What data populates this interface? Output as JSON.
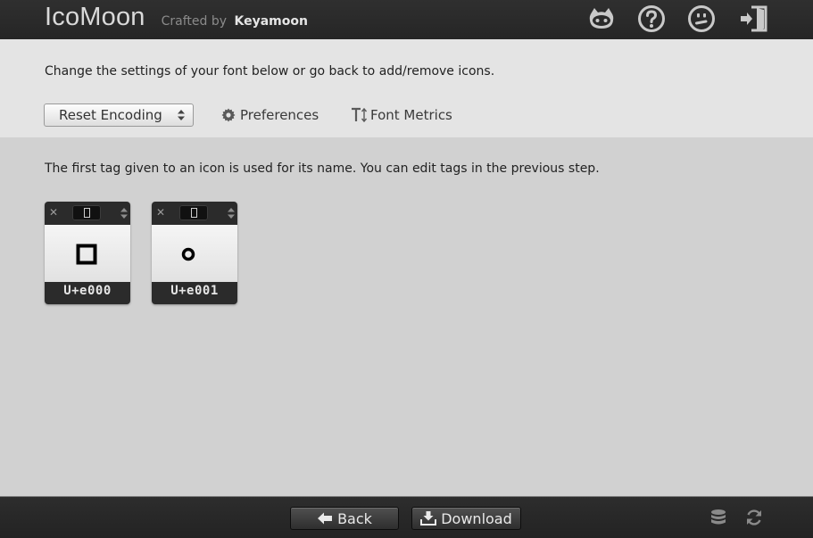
{
  "header": {
    "brand_name": "IcoMoon",
    "crafted_by": "Crafted by",
    "author": "Keyamoon",
    "icons": [
      "github-icon",
      "help-icon",
      "smiley-icon",
      "sign-out-icon"
    ]
  },
  "settings": {
    "intro_text": "Change the settings of your font below or go back to add/remove icons.",
    "encoding_select": "Reset Encoding",
    "preferences_label": "Preferences",
    "font_metrics_label": "Font Metrics"
  },
  "main": {
    "notice": "The first tag given to an icon is used for its name. You can edit tags in the previous step.",
    "glyphs": [
      {
        "code": "U+e000",
        "icon": "square-outline-icon"
      },
      {
        "code": "U+e001",
        "icon": "ring-icon"
      }
    ]
  },
  "footer": {
    "back_label": "Back",
    "download_label": "Download",
    "icons": [
      "database-icon",
      "refresh-icon"
    ]
  },
  "colors": {
    "header_bg": "#2a2a2a",
    "body_bg": "#d1d1d1",
    "band_bg": "#e4e4e4",
    "card_bg": "#2b2b2b"
  }
}
